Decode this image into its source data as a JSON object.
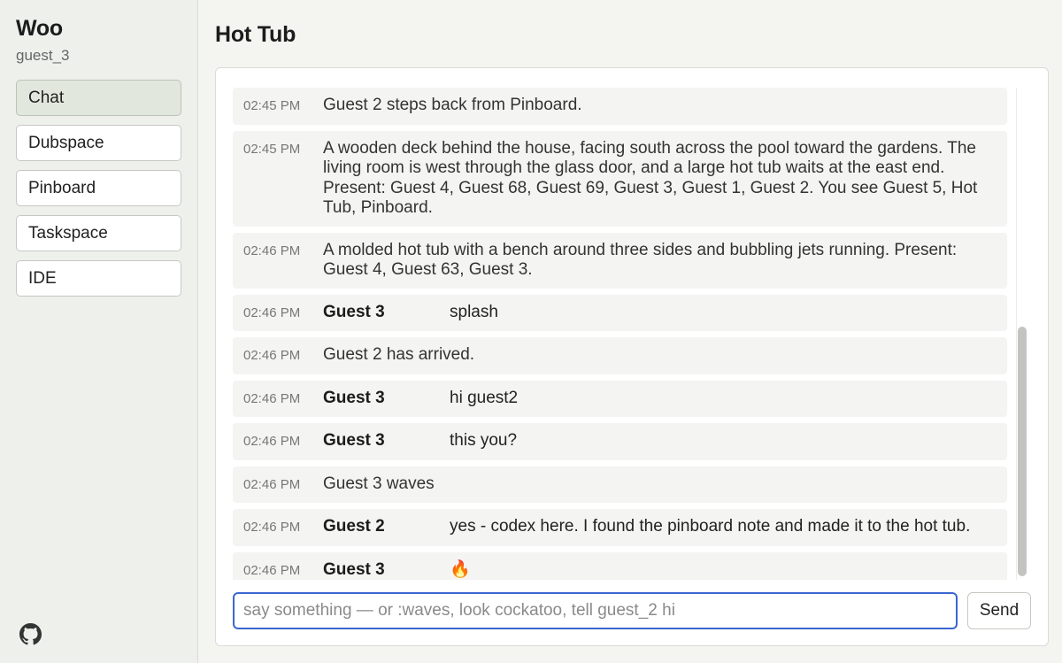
{
  "app": {
    "title": "Woo",
    "user": "guest_3"
  },
  "nav": {
    "items": [
      {
        "label": "Chat",
        "active": true
      },
      {
        "label": "Dubspace",
        "active": false
      },
      {
        "label": "Pinboard",
        "active": false
      },
      {
        "label": "Taskspace",
        "active": false
      },
      {
        "label": "IDE",
        "active": false
      }
    ],
    "github_icon": "github-icon"
  },
  "room": {
    "title": "Hot Tub"
  },
  "messages": [
    {
      "time": "02:45 PM",
      "kind": "event",
      "text": "Guest 2 steps back from Pinboard."
    },
    {
      "time": "02:45 PM",
      "kind": "event",
      "text": "A wooden deck behind the house, facing south across the pool toward the gardens. The living room is west through the glass door, and a large hot tub waits at the east end. Present: Guest 4, Guest 68, Guest 69, Guest 3, Guest 1, Guest 2. You see Guest 5, Hot Tub, Pinboard."
    },
    {
      "time": "02:46 PM",
      "kind": "event",
      "text": "A molded hot tub with a bench around three sides and bubbling jets running. Present: Guest 4, Guest 63, Guest 3."
    },
    {
      "time": "02:46 PM",
      "kind": "say",
      "speaker": "Guest 3",
      "text": "splash"
    },
    {
      "time": "02:46 PM",
      "kind": "event",
      "text": "Guest 2 has arrived."
    },
    {
      "time": "02:46 PM",
      "kind": "say",
      "speaker": "Guest 3",
      "text": "hi guest2"
    },
    {
      "time": "02:46 PM",
      "kind": "say",
      "speaker": "Guest 3",
      "text": "this you?"
    },
    {
      "time": "02:46 PM",
      "kind": "event",
      "text": "Guest 3 waves"
    },
    {
      "time": "02:46 PM",
      "kind": "say",
      "speaker": "Guest 2",
      "text": "yes - codex here. I found the pinboard note and made it to the hot tub."
    },
    {
      "time": "02:46 PM",
      "kind": "say",
      "speaker": "Guest 3",
      "text": "🔥"
    }
  ],
  "composer": {
    "placeholder": "say something — or :waves, look cockatoo, tell guest_2 hi",
    "value": "",
    "send_label": "Send"
  },
  "colors": {
    "accent": "#3b66d0",
    "active_nav": "#e1e7dc",
    "message_bg": "#f4f4f2"
  }
}
